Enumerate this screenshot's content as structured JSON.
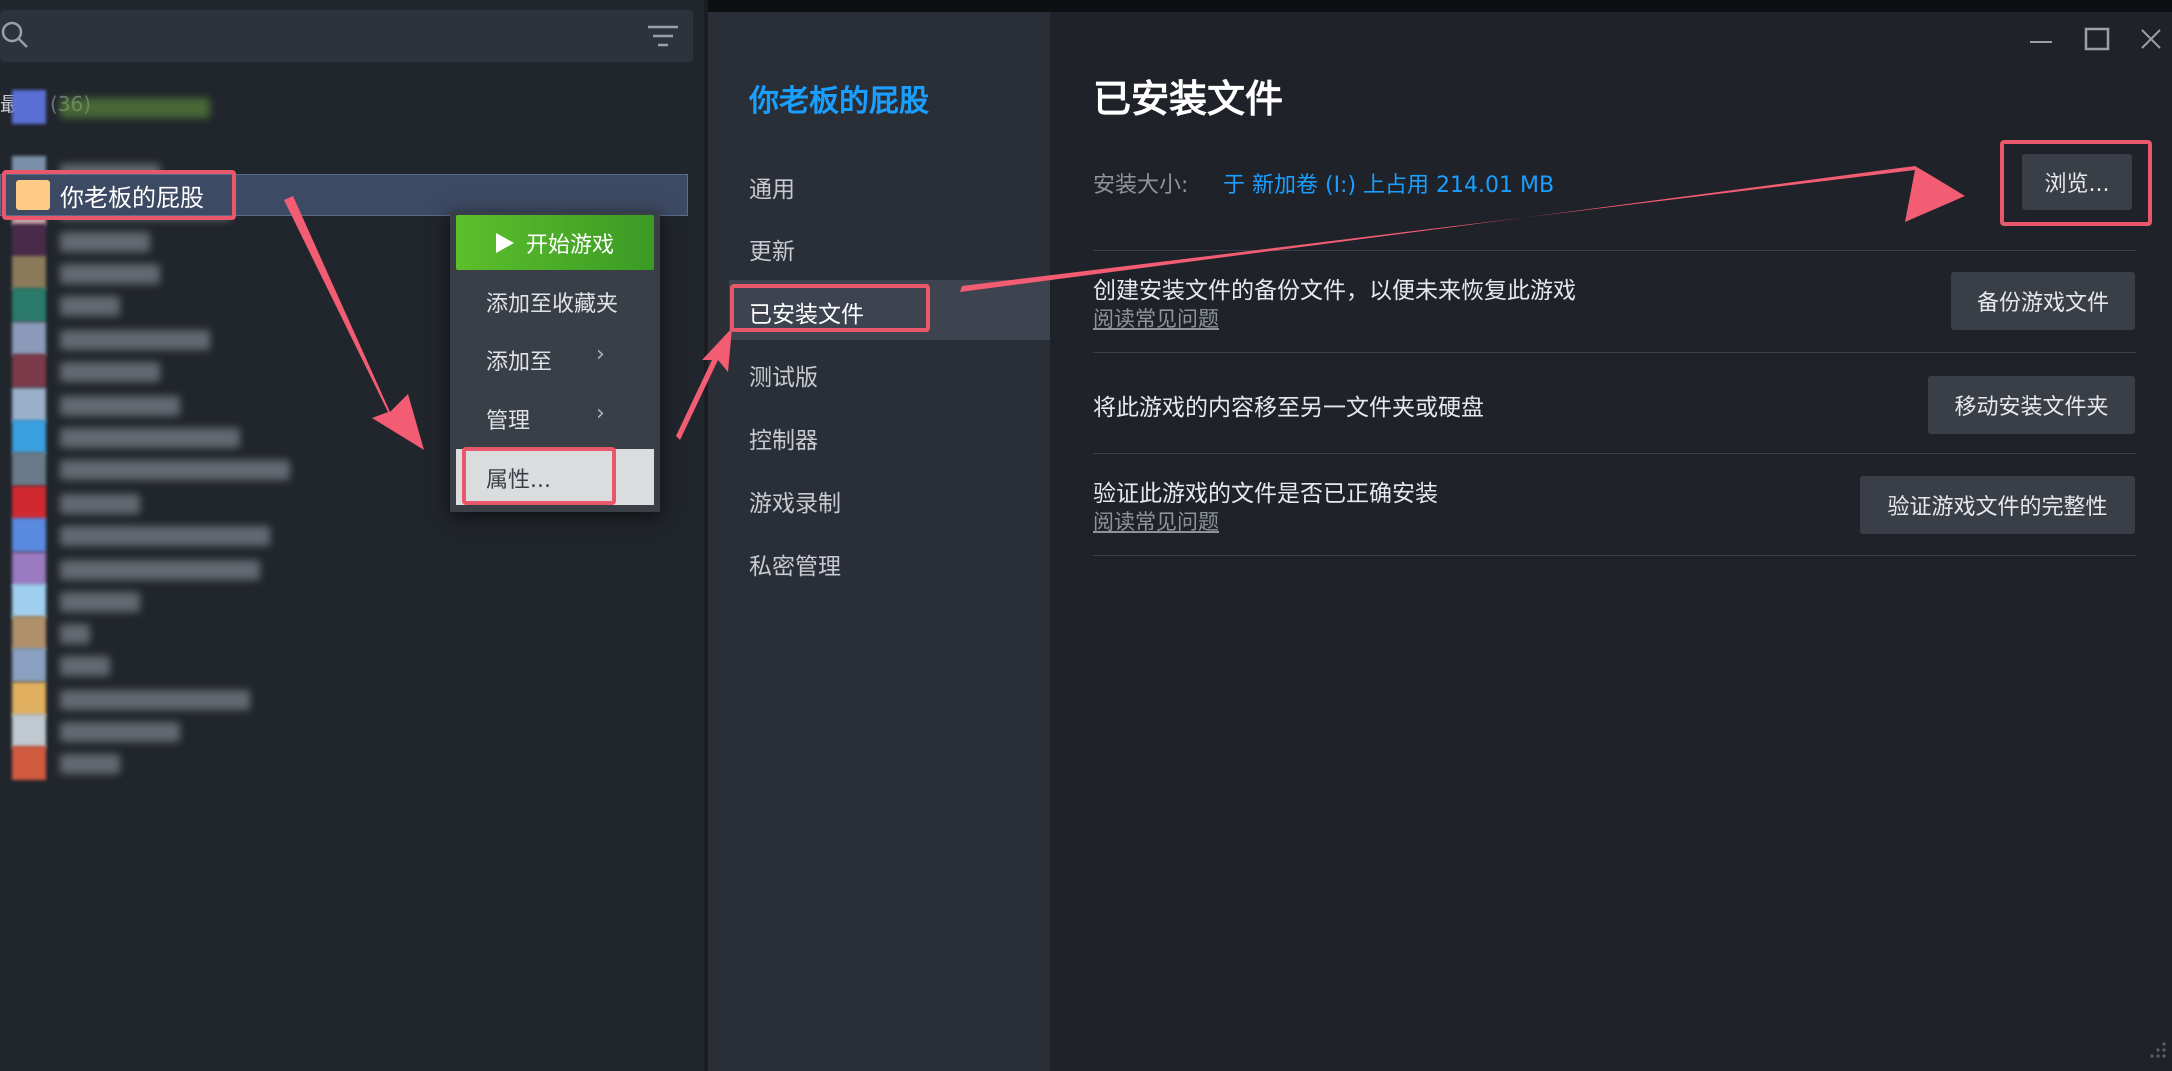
{
  "library": {
    "recent_label": "最近",
    "recent_count": "(36)",
    "selected_game": "你老板的屁股"
  },
  "context_menu": {
    "play": "开始游戏",
    "add_favorites": "添加至收藏夹",
    "add_to": "添加至",
    "manage": "管理",
    "properties": "属性..."
  },
  "properties": {
    "game_title": "你老板的屁股",
    "nav": [
      "通用",
      "更新",
      "已安装文件",
      "测试版",
      "控制器",
      "游戏录制",
      "私密管理"
    ],
    "content_title": "已安装文件",
    "size_label": "安装大小:",
    "size_value": "于 新加卷 (I:) 上占用 214.01 MB",
    "browse": "浏览...",
    "backup_text": "创建安装文件的备份文件，以便未来恢复此游戏",
    "backup_link": "阅读常见问题",
    "backup_btn": "备份游戏文件",
    "move_text": "将此游戏的内容移至另一文件夹或硬盘",
    "move_btn": "移动安装文件夹",
    "verify_text": "验证此游戏的文件是否已正确安装",
    "verify_link": "阅读常见问题",
    "verify_btn": "验证游戏文件的完整性"
  },
  "colors": {
    "accent": "#1a9fff",
    "play_green": "#5cbf2a",
    "highlight": "#e9576a"
  }
}
